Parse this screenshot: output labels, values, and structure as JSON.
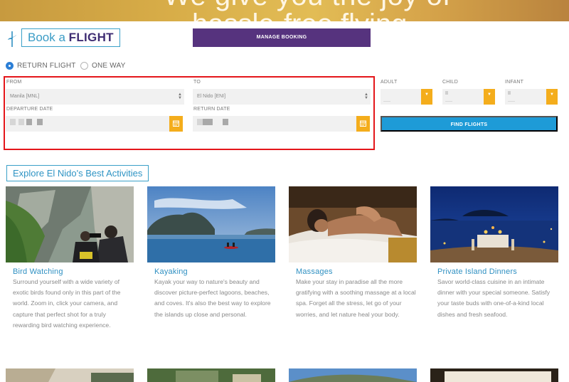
{
  "hero": {
    "line1": "We give you the joy of",
    "line2": "hassle-free flying"
  },
  "booking": {
    "title_prefix": "Book a ",
    "title_emphasis": "FLIGHT",
    "manage_label": "MANAGE BOOKING",
    "trip_types": [
      {
        "label": "RETURN FLIGHT",
        "selected": true
      },
      {
        "label": "ONE WAY",
        "selected": false
      }
    ],
    "from_label": "FROM",
    "from_value": "Manila [MNL]",
    "to_label": "TO",
    "to_value": "El Nido [ENI]",
    "departure_label": "DEPARTURE DATE",
    "return_label": "RETURN DATE",
    "adult_label": "ADULT",
    "child_label": "CHILD",
    "infant_label": "INFANT",
    "find_label": "FIND FLIGHTS"
  },
  "activities": {
    "heading": "Explore El Nido's Best Activities",
    "cards": [
      {
        "title": "Bird Watching",
        "description": "Surround yourself with a wide variety of exotic birds found only in this part of the world. Zoom in, click your camera, and capture that perfect shot for a truly rewarding bird watching experience."
      },
      {
        "title": "Kayaking",
        "description": "Kayak your way to nature's beauty and discover picture-perfect lagoons, beaches, and coves. It's also the best way to explore the islands up close and personal."
      },
      {
        "title": "Massages",
        "description": "Make your stay in paradise all the more gratifying with a soothing massage at a local spa. Forget all the stress, let go of your worries, and let nature heal your body."
      },
      {
        "title": "Private Island Dinners",
        "description": "Savor world-class cuisine in an intimate dinner with your special someone. Satisfy your taste buds with one-of-a-kind local dishes and fresh seafood."
      }
    ]
  },
  "colors": {
    "accent_blue": "#1e9bd7",
    "brand_purple": "#56337e",
    "calendar_orange": "#f4ad1c",
    "highlight_red": "#e4161a"
  }
}
